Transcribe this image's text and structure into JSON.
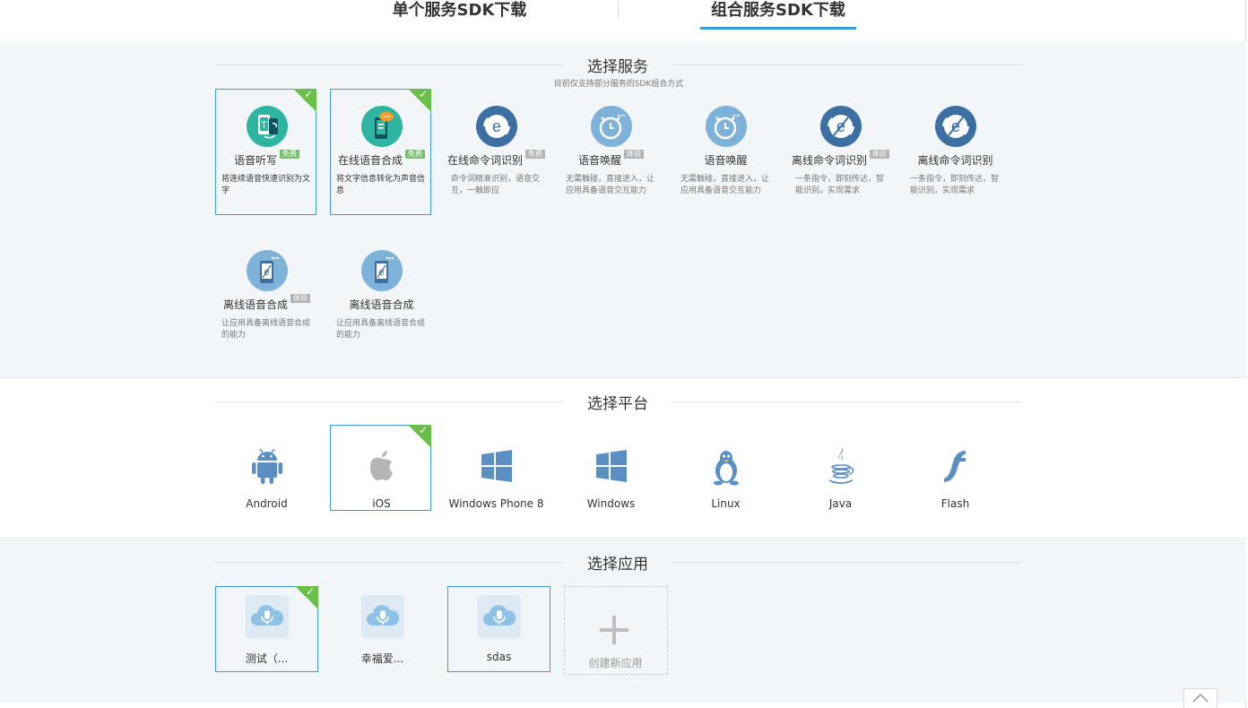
{
  "tabs": [
    {
      "label": "单个服务SDK下载",
      "active": false
    },
    {
      "label": "组合服务SDK下载",
      "active": true
    }
  ],
  "services_section": {
    "title": "选择服务",
    "subtitle": "目前仅支持部分服务的SDK组合方式",
    "items": [
      {
        "name": "语音听写",
        "badge": "免费",
        "desc": "将连续语音快速识别为文字",
        "selected": true,
        "icon": "speech-dictation-icon"
      },
      {
        "name": "在线语音合成",
        "badge": "免费",
        "desc": "将文字信息转化为声音信息",
        "selected": true,
        "icon": "online-tts-icon"
      },
      {
        "name": "在线命令词识别",
        "badge": "免费",
        "desc": "命令词精准识别，语音交互，一触即应",
        "selected": false,
        "icon": "online-command-icon"
      },
      {
        "name": "语音唤醒",
        "badge": "体验",
        "desc": "无需触碰，直接进入，让应用具备语音交互能力",
        "selected": false,
        "icon": "voice-wakeup-icon"
      },
      {
        "name": "语音唤醒",
        "badge": "",
        "desc": "无需触碰，直接进入，让应用具备语音交互能力",
        "selected": false,
        "icon": "voice-wakeup-icon"
      },
      {
        "name": "离线命令词识别",
        "badge": "体验",
        "desc": "一条指令，即刻传达，智能识别，实现需求",
        "selected": false,
        "icon": "offline-command-icon"
      },
      {
        "name": "离线命令词识别",
        "badge": "",
        "desc": "一条指令，即刻传达，智能识别，实现需求",
        "selected": false,
        "icon": "offline-command-icon"
      },
      {
        "name": "离线语音合成",
        "badge": "体验",
        "desc": "让应用具备离线语音合成的能力",
        "selected": false,
        "icon": "offline-tts-icon"
      },
      {
        "name": "离线语音合成",
        "badge": "",
        "desc": "让应用具备离线语音合成的能力",
        "selected": false,
        "icon": "offline-tts-icon"
      }
    ]
  },
  "platform_section": {
    "title": "选择平台",
    "items": [
      {
        "name": "Android",
        "selected": false,
        "icon": "android-icon"
      },
      {
        "name": "iOS",
        "selected": true,
        "icon": "apple-icon"
      },
      {
        "name": "Windows Phone 8",
        "selected": false,
        "icon": "windows-icon"
      },
      {
        "name": "Windows",
        "selected": false,
        "icon": "windows-icon"
      },
      {
        "name": "Linux",
        "selected": false,
        "icon": "linux-tux-icon"
      },
      {
        "name": "Java",
        "selected": false,
        "icon": "java-icon"
      },
      {
        "name": "Flash",
        "selected": false,
        "icon": "flash-icon"
      }
    ]
  },
  "apps_section": {
    "title": "选择应用",
    "items": [
      {
        "name": "测试（...",
        "selected": true,
        "checked": true,
        "icon": "cloud-mic-icon"
      },
      {
        "name": "幸福爱...",
        "selected": false,
        "checked": false,
        "icon": "cloud-mic-icon"
      },
      {
        "name": "sdas",
        "selected": true,
        "checked": false,
        "icon": "cloud-mic-icon"
      }
    ],
    "create_label": "创建新应用"
  },
  "colors": {
    "accent": "#3d9bd3",
    "check_green": "#6abf4b",
    "free_badge": "#79c06e",
    "trial_badge": "#b3b3b3",
    "icon_blue": "#3c6fa2",
    "icon_light_blue": "#7fb2d8"
  }
}
